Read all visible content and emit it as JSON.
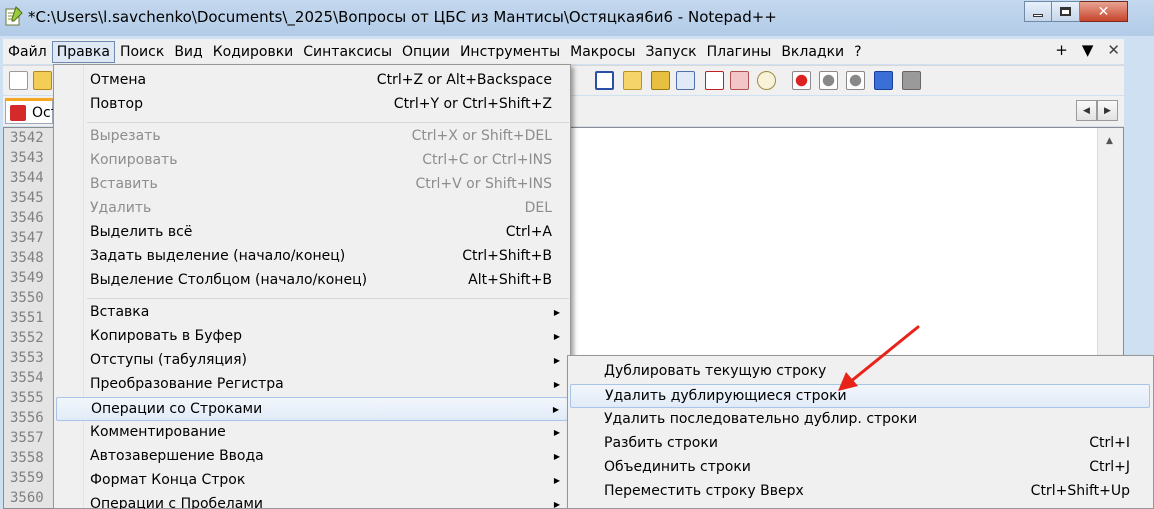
{
  "window": {
    "title": "*C:\\Users\\l.savchenko\\Documents\\_2025\\Вопросы от ЦБС из Мантисы\\Остяцкая6и6 - Notepad++"
  },
  "menubar": {
    "items": [
      "Файл",
      "Правка",
      "Поиск",
      "Вид",
      "Кодировки",
      "Синтаксисы",
      "Опции",
      "Инструменты",
      "Макросы",
      "Запуск",
      "Плагины",
      "Вкладки",
      "?"
    ],
    "right": [
      "+",
      "▼",
      "✕"
    ]
  },
  "tab": {
    "label": "Ост"
  },
  "editor": {
    "line_numbers": [
      "3542",
      "3543",
      "3544",
      "3545",
      "3546",
      "3547",
      "3548",
      "3549",
      "3550",
      "3551",
      "3552",
      "3553",
      "3554",
      "3555",
      "3556",
      "3557",
      "3558",
      "3559",
      "3560"
    ]
  },
  "edit_menu": {
    "items": [
      {
        "label": "Отмена",
        "shortcut": "Ctrl+Z or Alt+Backspace"
      },
      {
        "label": "Повтор",
        "shortcut": "Ctrl+Y or Ctrl+Shift+Z"
      },
      {
        "label": "Вырезать",
        "shortcut": "Ctrl+X or Shift+DEL"
      },
      {
        "label": "Копировать",
        "shortcut": "Ctrl+C or Ctrl+INS"
      },
      {
        "label": "Вставить",
        "shortcut": "Ctrl+V or Shift+INS"
      },
      {
        "label": "Удалить",
        "shortcut": "DEL"
      },
      {
        "label": "Выделить всё",
        "shortcut": "Ctrl+A"
      },
      {
        "label": "Задать выделение (начало/конец)",
        "shortcut": "Ctrl+Shift+B"
      },
      {
        "label": "Выделение Столбцом (начало/конец)",
        "shortcut": "Alt+Shift+B"
      },
      {
        "label": "Вставка"
      },
      {
        "label": "Копировать в Буфер"
      },
      {
        "label": "Отступы (табуляция)"
      },
      {
        "label": "Преобразование Регистра"
      },
      {
        "label": "Операции со Строками"
      },
      {
        "label": "Комментирование"
      },
      {
        "label": "Автозавершение Ввода"
      },
      {
        "label": "Формат Конца Строк"
      },
      {
        "label": "Операции с Пробелами"
      }
    ]
  },
  "line_ops_submenu": {
    "items": [
      {
        "label": "Дублировать текущую строку",
        "shortcut": ""
      },
      {
        "label": "Удалить дублирующиеся строки",
        "shortcut": ""
      },
      {
        "label": "Удалить последовательно дублир. строки",
        "shortcut": ""
      },
      {
        "label": "Разбить строки",
        "shortcut": "Ctrl+I"
      },
      {
        "label": "Объединить строки",
        "shortcut": "Ctrl+J"
      },
      {
        "label": "Переместить строку Вверх",
        "shortcut": "Ctrl+Shift+Up"
      }
    ]
  },
  "colors": {
    "highlight_border": "#a8c4e6",
    "disabled_text": "#8d8d8d",
    "annotation_arrow": "#e8231a"
  }
}
